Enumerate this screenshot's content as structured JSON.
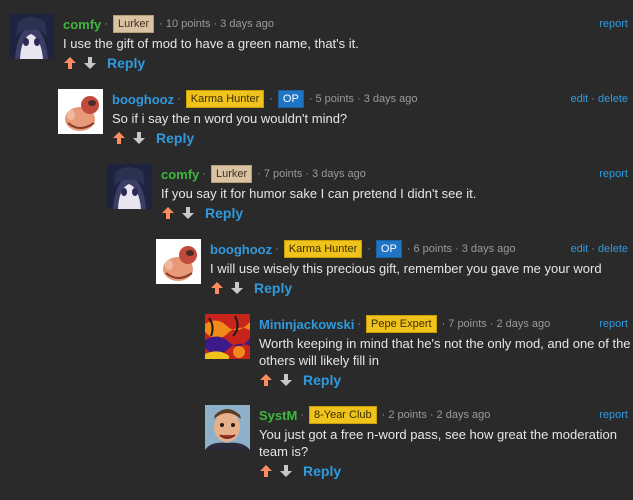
{
  "comments": [
    {
      "username": "comfy",
      "flairs": [
        "Lurker"
      ],
      "points": "10 points",
      "time": "3 days ago",
      "actions": [
        "report"
      ],
      "text": "I use the gift of mod to have a green name, that's it.",
      "reply_label": "Reply"
    },
    {
      "username": "booghooz",
      "flairs": [
        "Karma Hunter",
        "OP"
      ],
      "points": "5 points",
      "time": "3 days ago",
      "actions": [
        "edit",
        "delete"
      ],
      "text": "So if i say the n word you wouldn't mind?",
      "reply_label": "Reply"
    },
    {
      "username": "comfy",
      "flairs": [
        "Lurker"
      ],
      "points": "7 points",
      "time": "3 days ago",
      "actions": [
        "report"
      ],
      "text": "If you say it for humor sake I can pretend I didn't see it.",
      "reply_label": "Reply"
    },
    {
      "username": "booghooz",
      "flairs": [
        "Karma Hunter",
        "OP"
      ],
      "points": "6 points",
      "time": "3 days ago",
      "actions": [
        "edit",
        "delete"
      ],
      "text": "I will use wisely this precious gift, remember you gave me your word",
      "reply_label": "Reply"
    },
    {
      "username": "Mininjackowski",
      "flairs": [
        "Pepe Expert"
      ],
      "points": "7 points",
      "time": "2 days ago",
      "actions": [
        "report"
      ],
      "text": "Worth keeping in mind that he's not the only mod, and one of the others will likely fill in",
      "reply_label": "Reply"
    },
    {
      "username": "SystM",
      "flairs": [
        "8-Year Club"
      ],
      "points": "2 points",
      "time": "2 days ago",
      "actions": [
        "report"
      ],
      "text": "You just got a free n-word pass, see how great the moderation team is?",
      "reply_label": "Reply"
    }
  ],
  "colors": {
    "background": "#2a2a2a",
    "mod_name": "#3fb83f",
    "user_name": "#2f9ade",
    "link": "#2f9ade",
    "upvote": "#ff8b60",
    "downvote": "#c8c8c8"
  },
  "icons": {
    "upvote": "upvote-arrow-icon",
    "downvote": "downvote-arrow-icon"
  }
}
